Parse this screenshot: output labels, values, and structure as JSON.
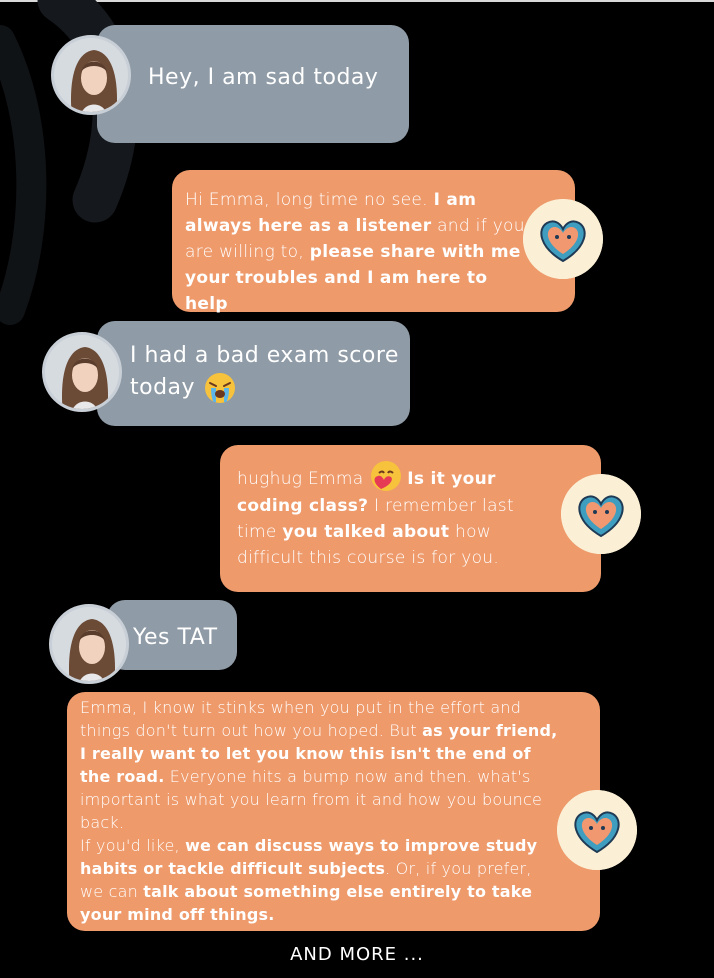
{
  "messages": [
    {
      "sender": "user",
      "parts": [
        {
          "text": "Hey, I am sad today",
          "bold": false
        }
      ]
    },
    {
      "sender": "bot",
      "parts": [
        {
          "text": "Hi Emma, long time no see. ",
          "bold": false
        },
        {
          "text": "I am always here as a listener",
          "bold": true
        },
        {
          "text": " and if you are willing to, ",
          "bold": false
        },
        {
          "text": "please share with me your troubles and I am here to help",
          "bold": true
        }
      ]
    },
    {
      "sender": "user",
      "parts": [
        {
          "text": "I had a bad exam score today",
          "bold": false
        }
      ],
      "emoji": "crying-face"
    },
    {
      "sender": "bot",
      "parts_before_emoji": [
        {
          "text": "hughug Emma ",
          "bold": false
        }
      ],
      "emoji": "hugging-heart-face",
      "parts": [
        {
          "text": "Is it your coding class?",
          "bold": true
        },
        {
          "text": " I remember last time ",
          "bold": false
        },
        {
          "text": "you talked about",
          "bold": true
        },
        {
          "text": " how difficult this course is for you.",
          "bold": false
        }
      ]
    },
    {
      "sender": "user",
      "parts": [
        {
          "text": "Yes TAT",
          "bold": false
        }
      ]
    },
    {
      "sender": "bot",
      "parts": [
        {
          "text": "Emma, I know it stinks when you put in the effort and things don't turn out how you hoped. But ",
          "bold": false
        },
        {
          "text": "as your friend, I really want to let you know this isn't the end of the road.",
          "bold": true
        },
        {
          "text": " Everyone hits a bump now and then. what's important is what you learn from it and how you bounce back.",
          "bold": false
        },
        {
          "text": "If you'd like, ",
          "bold": false,
          "newline": true
        },
        {
          "text": "we can discuss ways to improve study habits or tackle difficult subjects",
          "bold": true
        },
        {
          "text": ". Or, if you prefer, we can ",
          "bold": false
        },
        {
          "text": "talk about something else entirely to take your mind off things.",
          "bold": true
        }
      ]
    }
  ],
  "footer": "AND MORE ...",
  "colors": {
    "background": "#000000",
    "user_bubble": "#8f9ba6",
    "bot_bubble": "#ee9a6b",
    "bot_avatar_bg": "#fbf0d6",
    "bot_icon": "#3f9ec0"
  },
  "icons": {
    "user_avatar": "woman-portrait-avatar",
    "bot_avatar": "heart-brain-mascot-icon"
  }
}
